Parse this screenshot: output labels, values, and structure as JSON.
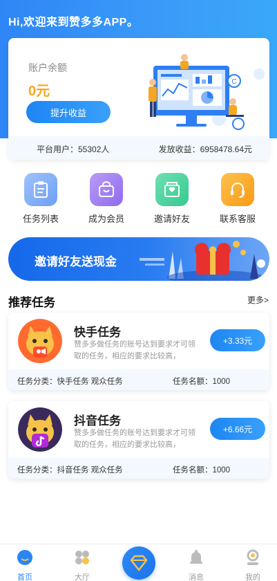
{
  "header": {
    "greeting": "Hi,欢迎来到赞多多APP。"
  },
  "balance": {
    "label": "账户余额",
    "value": "0元",
    "upgrade_button": "提升收益",
    "platform_users": "平台用户：55302人",
    "paid_out": "发放收益：6958478.64元"
  },
  "quick_actions": [
    {
      "label": "任务列表",
      "icon": "clipboard-icon",
      "color": "#8db7f6"
    },
    {
      "label": "成为会员",
      "icon": "shopping-bag-icon",
      "color": "#a58df2"
    },
    {
      "label": "邀请好友",
      "icon": "heart-envelope-icon",
      "color": "#4fd6a0"
    },
    {
      "label": "联系客服",
      "icon": "headset-icon",
      "color": "#fbb22a"
    }
  ],
  "banner": {
    "text": "邀请好友送现金"
  },
  "section": {
    "title": "推荐任务",
    "more": "更多>"
  },
  "tasks": [
    {
      "name": "快手任务",
      "desc": "赞多多做任务的账号达到要求才可领取的任务，相应的要求比较高，",
      "reward": "+3.33元",
      "category": "任务分类：快手任务 观众任务",
      "quota": "任务名额：1000",
      "avatar_color": "#ff6a2f",
      "icon": "kuaishou-cat-icon"
    },
    {
      "name": "抖音任务",
      "desc": "赞多多做任务的账号达到要求才可领取的任务，相应的要求比较高，",
      "reward": "+6.66元",
      "category": "任务分类：抖音任务 观众任务",
      "quota": "任务名额：1000",
      "avatar_color": "#3a2a5c",
      "icon": "douyin-cat-icon"
    }
  ],
  "tabbar": {
    "home": "首页",
    "hall": "大厅",
    "messages": "消息",
    "mine": "我的"
  },
  "colors": {
    "primary": "#2a86f3",
    "orange": "#f5a623"
  }
}
